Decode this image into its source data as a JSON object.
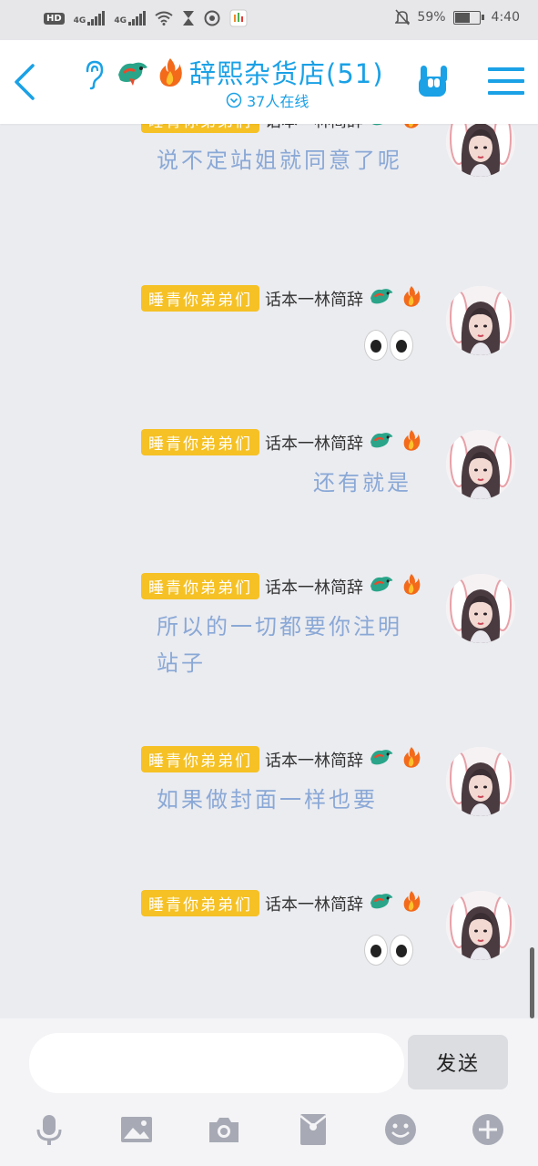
{
  "status_bar": {
    "hd": "HD",
    "net1": "4G",
    "net2": "4G",
    "battery_percent": "59%",
    "battery_level": 0.59,
    "time": "4:40"
  },
  "header": {
    "title": "辞熙杂货店(51)",
    "online": "37人在线",
    "accent": "#1aa1e6"
  },
  "messages": [
    {
      "badge": "睡青你弟弟们",
      "name": "话本一林简辞",
      "text": "说不定站姐就同意了呢",
      "emoji": ""
    },
    {
      "badge": "睡青你弟弟们",
      "name": "话本一林简辞",
      "text": "",
      "emoji": "eyes"
    },
    {
      "badge": "睡青你弟弟们",
      "name": "话本一林简辞",
      "text": "还有就是",
      "emoji": ""
    },
    {
      "badge": "睡青你弟弟们",
      "name": "话本一林简辞",
      "text": "所以的一切都要你注明站子",
      "emoji": ""
    },
    {
      "badge": "睡青你弟弟们",
      "name": "话本一林简辞",
      "text": "如果做封面一样也要",
      "emoji": ""
    },
    {
      "badge": "睡青你弟弟们",
      "name": "话本一林简辞",
      "text": "",
      "emoji": "eyes"
    }
  ],
  "input": {
    "placeholder": "",
    "send_label": "发送"
  },
  "toolbar": [
    "mic-icon",
    "image-icon",
    "camera-icon",
    "red-packet-icon",
    "emoji-icon",
    "plus-icon"
  ],
  "colors": {
    "badge": "#f5c125",
    "message_text": "#8aa8d6",
    "icon_gray": "#a7aab5"
  }
}
